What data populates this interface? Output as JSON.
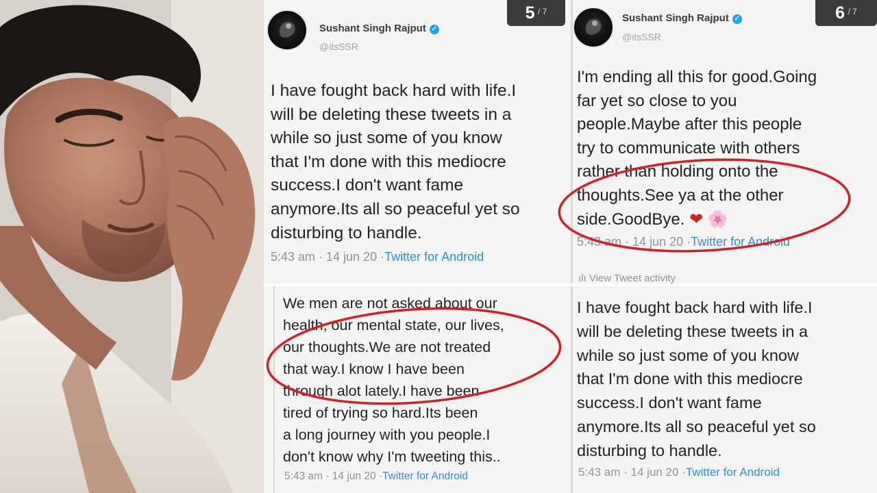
{
  "photo": {
    "alt": "Portrait of a man with eyes closed resting his face on his hand"
  },
  "tweet_top_left": {
    "author": "Sushant Singh Rajput",
    "handle": "@itsSSR",
    "lines": [
      "I have fought back hard with life.I",
      "will be deleting these tweets in a",
      "while so just some of you know",
      "that I'm done with this mediocre",
      "success.I don't want fame",
      "anymore.Its all so peaceful yet so",
      "disturbing to handle."
    ],
    "time": "5:43 am · 14 jun 20 ·",
    "source": "Twitter for Android",
    "counter_current": "5",
    "counter_total": "/ 7"
  },
  "tweet_top_right": {
    "author": "Sushant Singh Rajput",
    "handle": "@itsSSR",
    "lines": [
      "I'm ending all this for good.Going",
      "far yet so close to you",
      "people.Maybe after this people",
      "try to communicate with others",
      "rather than holding onto the",
      "thoughts.See ya at the other",
      "side.GoodBye."
    ],
    "emoji": "❤ 🌸",
    "time": "5:43 am · 14 jun 20 ·",
    "source": "Twitter for Android",
    "activity": "View Tweet activity",
    "counter_current": "6",
    "counter_total": "/ 7"
  },
  "tweet_bottom_left": {
    "lines": [
      "We men are not asked about our",
      "health, our mental state, our lives,",
      "our thoughts.We are not treated",
      "that way.I know I have been",
      "through alot lately.I have been",
      "tired of trying so hard.Its been",
      "a long journey with you people.I",
      "don't know why I'm tweeting this.."
    ],
    "time": "5:43 am · 14 jun 20 ·",
    "source": "Twitter for Android"
  },
  "tweet_bottom_right": {
    "lines": [
      "I have fought back hard with life.I",
      "will be deleting these tweets in a",
      "while so just some of you know",
      "that I'm done with this mediocre",
      "success.I don't want fame",
      "anymore.Its all so peaceful yet so",
      "disturbing to handle."
    ],
    "time": "5:43 am · 14 jun 20 ·",
    "source": "Twitter for Android"
  },
  "colors": {
    "annotation_ring": "#d0202a",
    "link": "#2a8fd8",
    "verified": "#1da1f2"
  }
}
